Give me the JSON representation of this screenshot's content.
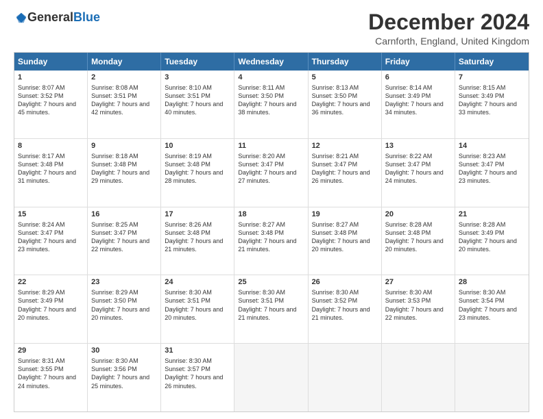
{
  "logo": {
    "general": "General",
    "blue": "Blue"
  },
  "title": "December 2024",
  "location": "Carnforth, England, United Kingdom",
  "weekdays": [
    "Sunday",
    "Monday",
    "Tuesday",
    "Wednesday",
    "Thursday",
    "Friday",
    "Saturday"
  ],
  "rows": [
    [
      {
        "day": "1",
        "sunrise": "Sunrise: 8:07 AM",
        "sunset": "Sunset: 3:52 PM",
        "daylight": "Daylight: 7 hours and 45 minutes."
      },
      {
        "day": "2",
        "sunrise": "Sunrise: 8:08 AM",
        "sunset": "Sunset: 3:51 PM",
        "daylight": "Daylight: 7 hours and 42 minutes."
      },
      {
        "day": "3",
        "sunrise": "Sunrise: 8:10 AM",
        "sunset": "Sunset: 3:51 PM",
        "daylight": "Daylight: 7 hours and 40 minutes."
      },
      {
        "day": "4",
        "sunrise": "Sunrise: 8:11 AM",
        "sunset": "Sunset: 3:50 PM",
        "daylight": "Daylight: 7 hours and 38 minutes."
      },
      {
        "day": "5",
        "sunrise": "Sunrise: 8:13 AM",
        "sunset": "Sunset: 3:50 PM",
        "daylight": "Daylight: 7 hours and 36 minutes."
      },
      {
        "day": "6",
        "sunrise": "Sunrise: 8:14 AM",
        "sunset": "Sunset: 3:49 PM",
        "daylight": "Daylight: 7 hours and 34 minutes."
      },
      {
        "day": "7",
        "sunrise": "Sunrise: 8:15 AM",
        "sunset": "Sunset: 3:49 PM",
        "daylight": "Daylight: 7 hours and 33 minutes."
      }
    ],
    [
      {
        "day": "8",
        "sunrise": "Sunrise: 8:17 AM",
        "sunset": "Sunset: 3:48 PM",
        "daylight": "Daylight: 7 hours and 31 minutes."
      },
      {
        "day": "9",
        "sunrise": "Sunrise: 8:18 AM",
        "sunset": "Sunset: 3:48 PM",
        "daylight": "Daylight: 7 hours and 29 minutes."
      },
      {
        "day": "10",
        "sunrise": "Sunrise: 8:19 AM",
        "sunset": "Sunset: 3:48 PM",
        "daylight": "Daylight: 7 hours and 28 minutes."
      },
      {
        "day": "11",
        "sunrise": "Sunrise: 8:20 AM",
        "sunset": "Sunset: 3:47 PM",
        "daylight": "Daylight: 7 hours and 27 minutes."
      },
      {
        "day": "12",
        "sunrise": "Sunrise: 8:21 AM",
        "sunset": "Sunset: 3:47 PM",
        "daylight": "Daylight: 7 hours and 26 minutes."
      },
      {
        "day": "13",
        "sunrise": "Sunrise: 8:22 AM",
        "sunset": "Sunset: 3:47 PM",
        "daylight": "Daylight: 7 hours and 24 minutes."
      },
      {
        "day": "14",
        "sunrise": "Sunrise: 8:23 AM",
        "sunset": "Sunset: 3:47 PM",
        "daylight": "Daylight: 7 hours and 23 minutes."
      }
    ],
    [
      {
        "day": "15",
        "sunrise": "Sunrise: 8:24 AM",
        "sunset": "Sunset: 3:47 PM",
        "daylight": "Daylight: 7 hours and 23 minutes."
      },
      {
        "day": "16",
        "sunrise": "Sunrise: 8:25 AM",
        "sunset": "Sunset: 3:47 PM",
        "daylight": "Daylight: 7 hours and 22 minutes."
      },
      {
        "day": "17",
        "sunrise": "Sunrise: 8:26 AM",
        "sunset": "Sunset: 3:48 PM",
        "daylight": "Daylight: 7 hours and 21 minutes."
      },
      {
        "day": "18",
        "sunrise": "Sunrise: 8:27 AM",
        "sunset": "Sunset: 3:48 PM",
        "daylight": "Daylight: 7 hours and 21 minutes."
      },
      {
        "day": "19",
        "sunrise": "Sunrise: 8:27 AM",
        "sunset": "Sunset: 3:48 PM",
        "daylight": "Daylight: 7 hours and 20 minutes."
      },
      {
        "day": "20",
        "sunrise": "Sunrise: 8:28 AM",
        "sunset": "Sunset: 3:48 PM",
        "daylight": "Daylight: 7 hours and 20 minutes."
      },
      {
        "day": "21",
        "sunrise": "Sunrise: 8:28 AM",
        "sunset": "Sunset: 3:49 PM",
        "daylight": "Daylight: 7 hours and 20 minutes."
      }
    ],
    [
      {
        "day": "22",
        "sunrise": "Sunrise: 8:29 AM",
        "sunset": "Sunset: 3:49 PM",
        "daylight": "Daylight: 7 hours and 20 minutes."
      },
      {
        "day": "23",
        "sunrise": "Sunrise: 8:29 AM",
        "sunset": "Sunset: 3:50 PM",
        "daylight": "Daylight: 7 hours and 20 minutes."
      },
      {
        "day": "24",
        "sunrise": "Sunrise: 8:30 AM",
        "sunset": "Sunset: 3:51 PM",
        "daylight": "Daylight: 7 hours and 20 minutes."
      },
      {
        "day": "25",
        "sunrise": "Sunrise: 8:30 AM",
        "sunset": "Sunset: 3:51 PM",
        "daylight": "Daylight: 7 hours and 21 minutes."
      },
      {
        "day": "26",
        "sunrise": "Sunrise: 8:30 AM",
        "sunset": "Sunset: 3:52 PM",
        "daylight": "Daylight: 7 hours and 21 minutes."
      },
      {
        "day": "27",
        "sunrise": "Sunrise: 8:30 AM",
        "sunset": "Sunset: 3:53 PM",
        "daylight": "Daylight: 7 hours and 22 minutes."
      },
      {
        "day": "28",
        "sunrise": "Sunrise: 8:30 AM",
        "sunset": "Sunset: 3:54 PM",
        "daylight": "Daylight: 7 hours and 23 minutes."
      }
    ],
    [
      {
        "day": "29",
        "sunrise": "Sunrise: 8:31 AM",
        "sunset": "Sunset: 3:55 PM",
        "daylight": "Daylight: 7 hours and 24 minutes."
      },
      {
        "day": "30",
        "sunrise": "Sunrise: 8:30 AM",
        "sunset": "Sunset: 3:56 PM",
        "daylight": "Daylight: 7 hours and 25 minutes."
      },
      {
        "day": "31",
        "sunrise": "Sunrise: 8:30 AM",
        "sunset": "Sunset: 3:57 PM",
        "daylight": "Daylight: 7 hours and 26 minutes."
      },
      {
        "day": "",
        "sunrise": "",
        "sunset": "",
        "daylight": ""
      },
      {
        "day": "",
        "sunrise": "",
        "sunset": "",
        "daylight": ""
      },
      {
        "day": "",
        "sunrise": "",
        "sunset": "",
        "daylight": ""
      },
      {
        "day": "",
        "sunrise": "",
        "sunset": "",
        "daylight": ""
      }
    ]
  ]
}
